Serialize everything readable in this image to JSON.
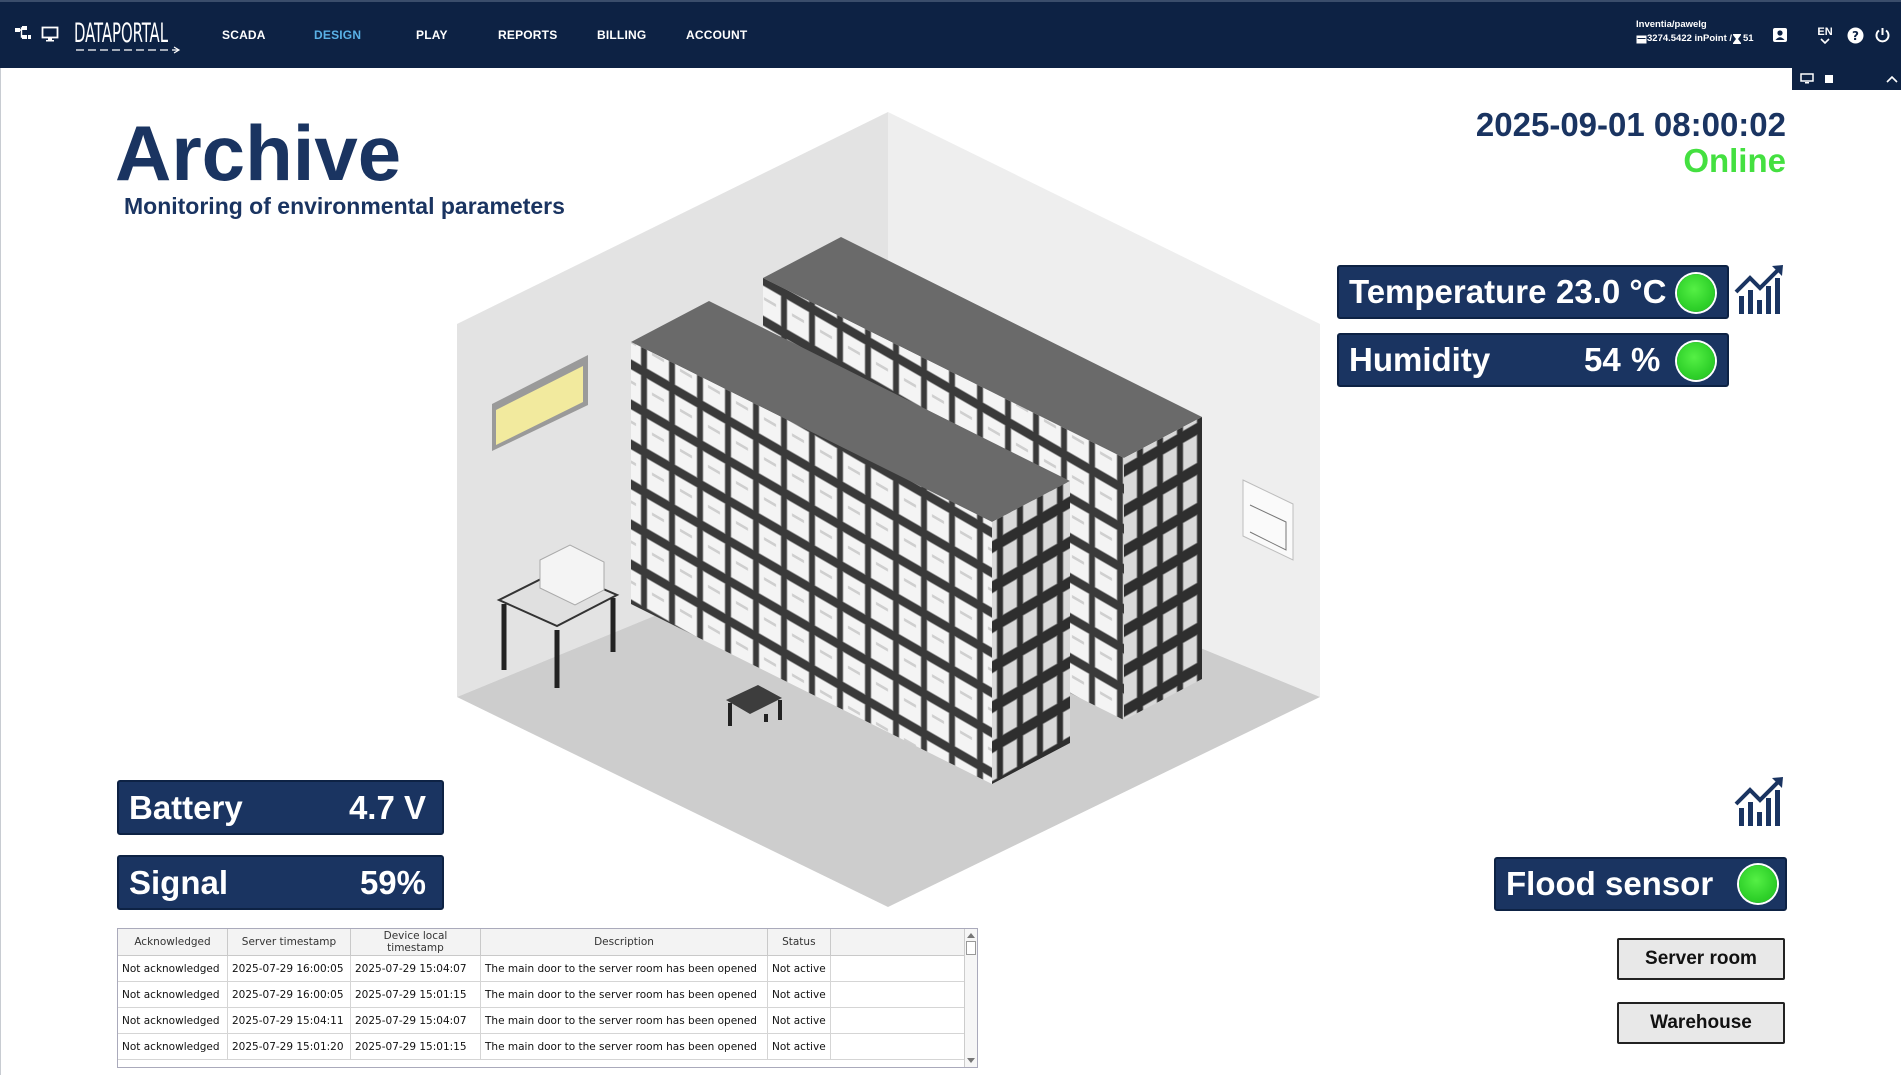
{
  "nav": {
    "logo": "DATAPORTAL",
    "items": [
      {
        "label": "SCADA"
      },
      {
        "label": "DESIGN"
      },
      {
        "label": "PLAY"
      },
      {
        "label": "REPORTS"
      },
      {
        "label": "BILLING"
      },
      {
        "label": "ACCOUNT"
      }
    ],
    "user": "Inventia/pawelg",
    "balance": "3274.5422 inPoint / ",
    "hourglass_count": "51",
    "lang": "EN"
  },
  "header": {
    "title": "Archive",
    "subtitle": "Monitoring of environmental parameters",
    "datetime": "2025-09-01 08:00:02",
    "status": "Online"
  },
  "sensors": {
    "temperature": {
      "label": "Temperature",
      "value": "23.0 °C"
    },
    "humidity": {
      "label": "Humidity",
      "value": "54",
      "unit": "%"
    },
    "battery": {
      "label": "Battery",
      "value": "4.7 V"
    },
    "signal": {
      "label": "Signal",
      "value": "59%"
    },
    "flood": {
      "label": "Flood sensor"
    }
  },
  "buttons": {
    "server_room": "Server room",
    "warehouse": "Warehouse"
  },
  "alarms": {
    "columns": [
      "Acknowledged",
      "Server timestamp",
      "Device local timestamp",
      "Description",
      "Status"
    ],
    "rows": [
      [
        "Not acknowledged",
        "2025-07-29 16:00:05",
        "2025-07-29 15:04:07",
        "The main door to the server room has been opened",
        "Not active"
      ],
      [
        "Not acknowledged",
        "2025-07-29 16:00:05",
        "2025-07-29 15:01:15",
        "The main door to the server room has been opened",
        "Not active"
      ],
      [
        "Not acknowledged",
        "2025-07-29 15:04:11",
        "2025-07-29 15:04:07",
        "The main door to the server room has been opened",
        "Not active"
      ],
      [
        "Not acknowledged",
        "2025-07-29 15:01:20",
        "2025-07-29 15:01:15",
        "The main door to the server room has been opened",
        "Not active"
      ]
    ]
  },
  "colors": {
    "navy": "#1a3461",
    "topbar": "#0d2244",
    "active_nav": "#5ab1e6",
    "online": "#44e040",
    "led": "#2fd12a"
  },
  "icons": [
    "sitemap-icon",
    "monitor-icon",
    "user-card-icon",
    "chevron-down-icon",
    "help-icon",
    "power-icon",
    "trend-chart-icon"
  ]
}
